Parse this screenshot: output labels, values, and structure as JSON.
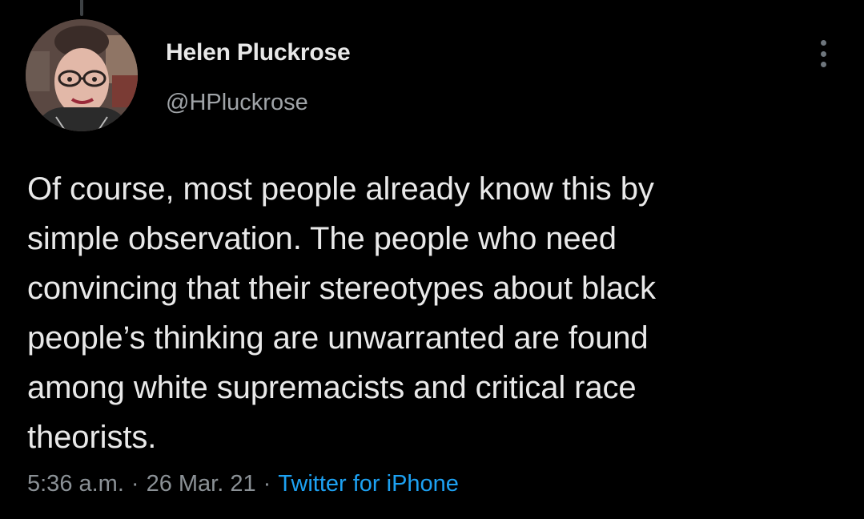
{
  "tweet": {
    "author": {
      "display_name": "Helen Pluckrose",
      "handle": "@HPluckrose"
    },
    "text": "Of course, most people already know this by\nsimple observation. The people who need\nconvincing that their stereotypes about black\npeople’s thinking are unwarranted are found\namong white supremacists and critical race\ntheorists.",
    "time": "5:36 a.m.",
    "separator": "·",
    "date": "26 Mar. 21",
    "source": "Twitter for iPhone"
  },
  "icons": {
    "more": "more-vertical-icon"
  },
  "colors": {
    "background": "#000000",
    "link": "#1da1f2",
    "secondary_text": "#8b9196"
  }
}
